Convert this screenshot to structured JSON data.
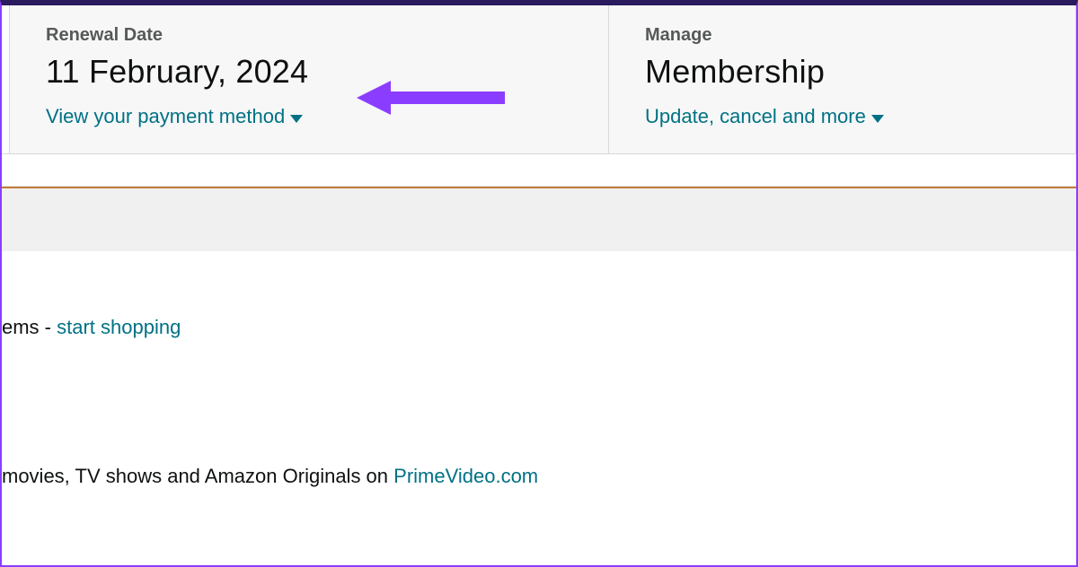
{
  "renewal": {
    "label": "Renewal Date",
    "value": "11 February, 2024",
    "link": "View your payment method"
  },
  "manage": {
    "label": "Manage",
    "value": "Membership",
    "link": "Update, cancel and more"
  },
  "content": {
    "line1_prefix": "ems - ",
    "line1_link": "start shopping",
    "line2_prefix": "movies, TV shows and Amazon Originals on ",
    "line2_link": "PrimeVideo.com"
  }
}
